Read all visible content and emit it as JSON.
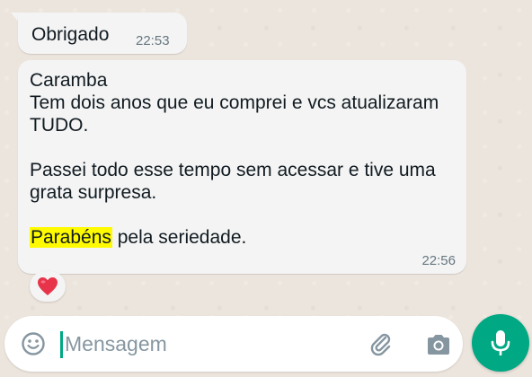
{
  "messages": [
    {
      "text": "Obrigado",
      "time": "22:53"
    },
    {
      "line1": "Caramba",
      "line2": "Tem dois anos que eu comprei e vcs atualizaram TUDO.",
      "line3": "Passei todo esse tempo sem acessar e tive uma grata surpresa.",
      "highlight": "Parabéns",
      "line4_rest": " pela seriedade.",
      "time": "22:56",
      "reaction": "heart"
    }
  ],
  "composer": {
    "placeholder": "Mensagem",
    "emoji_icon": "emoji-icon",
    "attach_icon": "paperclip-icon",
    "camera_icon": "camera-icon",
    "mic_icon": "microphone-icon"
  },
  "colors": {
    "accent": "#00a884",
    "highlight": "#fffa00",
    "bubble": "#f4f4f4",
    "background": "#ece5dd"
  }
}
